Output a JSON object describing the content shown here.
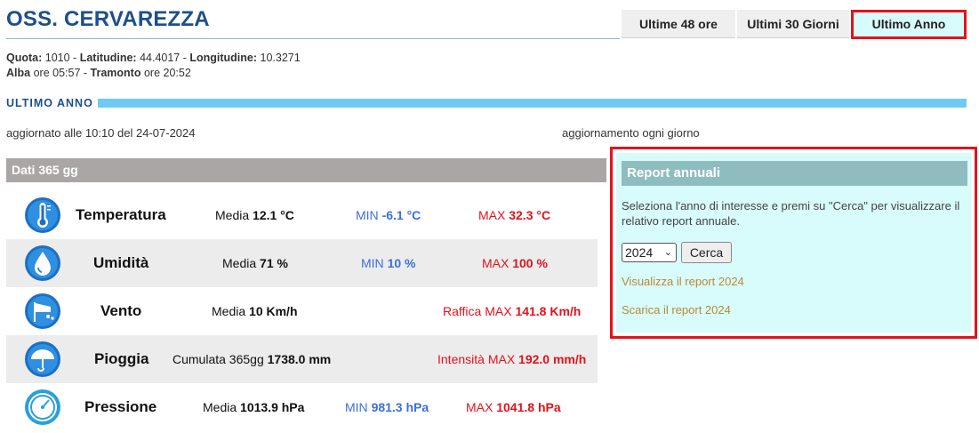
{
  "station": {
    "title": "OSS. CERVAREZZA",
    "meta": {
      "quota_label": "Quota:",
      "quota": "1010",
      "lat_label": "Latitudine:",
      "lat": "44.4017",
      "lon_label": "Longitudine:",
      "lon": "10.3271",
      "alba_label": "Alba",
      "alba": "ore 05:57",
      "tramonto_label": "Tramonto",
      "tramonto": "ore 20:52"
    }
  },
  "tabs": [
    {
      "label": "Ultime 48 ore",
      "active": false
    },
    {
      "label": "Ultimi 30 Giorni",
      "active": false
    },
    {
      "label": "Ultimo Anno",
      "active": true
    }
  ],
  "section": {
    "label": "ULTIMO ANNO",
    "updated": "aggiornato alle 10:10 del 24-07-2024",
    "frequency": "aggiornamento ogni giorno"
  },
  "data_table": {
    "header": "Dati 365 gg",
    "rows": [
      {
        "icon": "thermometer-icon",
        "name": "Temperatura",
        "c1_label": "Media",
        "c1_value": "12.1 °C",
        "c2_label": "MIN",
        "c2_value": "-6.1 °C",
        "c3_label": "MAX",
        "c3_value": "32.3 °C"
      },
      {
        "icon": "humidity-drop-icon",
        "name": "Umidità",
        "c1_label": "Media",
        "c1_value": "71 %",
        "c2_label": "MIN",
        "c2_value": "10 %",
        "c3_label": "MAX",
        "c3_value": "100 %"
      },
      {
        "icon": "wind-icon",
        "name": "Vento",
        "c1_label": "Media",
        "c1_value": "10 Km/h",
        "c2_label": "",
        "c2_value": "",
        "c3_label": "Raffica MAX",
        "c3_value": "141.8 Km/h"
      },
      {
        "icon": "umbrella-rain-icon",
        "name": "Pioggia",
        "c1_label": "Cumulata 365gg",
        "c1_value": "1738.0 mm",
        "c2_label": "",
        "c2_value": "",
        "c3_label": "Intensità MAX",
        "c3_value": "192.0 mm/h"
      },
      {
        "icon": "barometer-icon",
        "name": "Pressione",
        "c1_label": "Media",
        "c1_value": "1013.9 hPa",
        "c2_label": "MIN",
        "c2_value": "981.3 hPa",
        "c3_label": "MAX",
        "c3_value": "1041.8 hPa"
      }
    ]
  },
  "report": {
    "title": "Report annuali",
    "description": "Seleziona l'anno di interesse e premi su \"Cerca\" per visualizzare il relativo report annuale.",
    "year_selected": "2024",
    "search_label": "Cerca",
    "view_link": "Visualizza il report 2024",
    "download_link": "Scarica il report 2024"
  },
  "colors": {
    "title_blue": "#1c4f8c",
    "section_bar": "#6dcaf4",
    "min_blue": "#3a6fe0",
    "max_red": "#e3121b",
    "report_bg": "#d8fbfb",
    "report_header": "#8fbdbf",
    "link_gold": "#b98a32",
    "highlight_border": "#e3121b"
  }
}
